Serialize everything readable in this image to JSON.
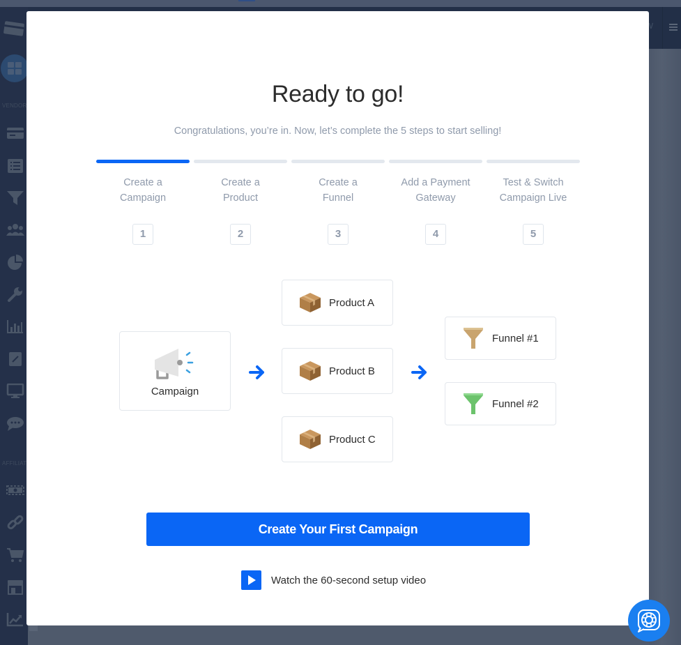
{
  "background_app": {
    "sidebar": {
      "section_labels": [
        "VENDOR",
        "AFFILIATE"
      ],
      "icons": [
        "credit-card-logo-icon",
        "dashboard-grid-icon",
        "credit-card-icon",
        "list-icon",
        "funnel-icon",
        "users-icon",
        "pie-chart-icon",
        "wrench-icon",
        "bar-chart-icon",
        "edit-icon",
        "monitor-icon",
        "chat-icon",
        "money-icon",
        "link-icon",
        "cart-icon",
        "store-icon",
        "trending-chart-icon"
      ]
    }
  },
  "modal": {
    "title": "Ready to go!",
    "subtitle": "Congratulations, you’re in. Now, let’s complete the 5 steps to start selling!",
    "steps": [
      {
        "line1": "Create a",
        "line2": "Campaign",
        "number": "1",
        "active": true
      },
      {
        "line1": "Create a",
        "line2": "Product",
        "number": "2",
        "active": false
      },
      {
        "line1": "Create a",
        "line2": "Funnel",
        "number": "3",
        "active": false
      },
      {
        "line1": "Add a Payment",
        "line2": "Gateway",
        "number": "4",
        "active": false
      },
      {
        "line1": "Test & Switch",
        "line2": "Campaign Live",
        "number": "5",
        "active": false
      }
    ],
    "diagram": {
      "campaign": {
        "label": "Campaign",
        "icon": "megaphone-icon"
      },
      "products": [
        {
          "label": "Product A",
          "icon": "box-icon"
        },
        {
          "label": "Product B",
          "icon": "box-icon"
        },
        {
          "label": "Product C",
          "icon": "box-icon"
        }
      ],
      "funnels": [
        {
          "label": "Funnel #1",
          "icon": "funnel-icon",
          "color": "#c9a46e"
        },
        {
          "label": "Funnel #2",
          "icon": "funnel-icon",
          "color": "#6cc36c"
        }
      ]
    },
    "cta_label": "Create Your First Campaign",
    "video_link_label": "Watch the 60-second setup video"
  },
  "colors": {
    "accent": "#0a66f5",
    "muted_text": "#8f9aab",
    "help_button": "#1a7ff0",
    "sidebar_bg": "#243049"
  }
}
